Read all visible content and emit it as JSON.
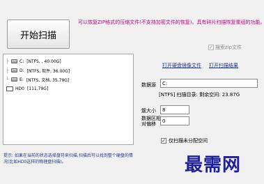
{
  "start_button": "开始扫描",
  "notice": {
    "line1": "可以恢复ZIP格式的压缩文件(不支持加密文件的恢复)。具有碎片扫描恢复重组的功能。"
  },
  "search_zip": {
    "label": "搜索zip文件",
    "checked": true
  },
  "tree": {
    "items": [
      {
        "letter": "C:",
        "info": "[NTFS, , 40.00G]"
      },
      {
        "letter": "D:",
        "info": "[NTFS, 软件, 36.00G]"
      },
      {
        "letter": "E:",
        "info": "[NTFS, 文档, 35.79G]"
      }
    ],
    "hdd": {
      "letter": "HD0",
      "info": "[111.79G]"
    }
  },
  "links": {
    "open_folder": "打开硬盘镜像文件",
    "open_results": "打开扫描结果"
  },
  "data_source": {
    "label": "数据源",
    "value": "C:"
  },
  "scan_status": "[NTFS] 扫描目录: 剩余空间: 23.87G",
  "cluster_size": {
    "label": "簇大小",
    "value": "8"
  },
  "start_sector": {
    "label": "数据区相\n对偏移",
    "value": "0"
  },
  "unallocated_only": {
    "label": "仅扫描未分配空间",
    "checked": true
  },
  "hint": "提示: 如果在当前的状态选择盘符来扫描,扫描后可以找到整个硬盘的情况(比如HD0这样的物理盘扫描)。",
  "watermark": "最需网"
}
